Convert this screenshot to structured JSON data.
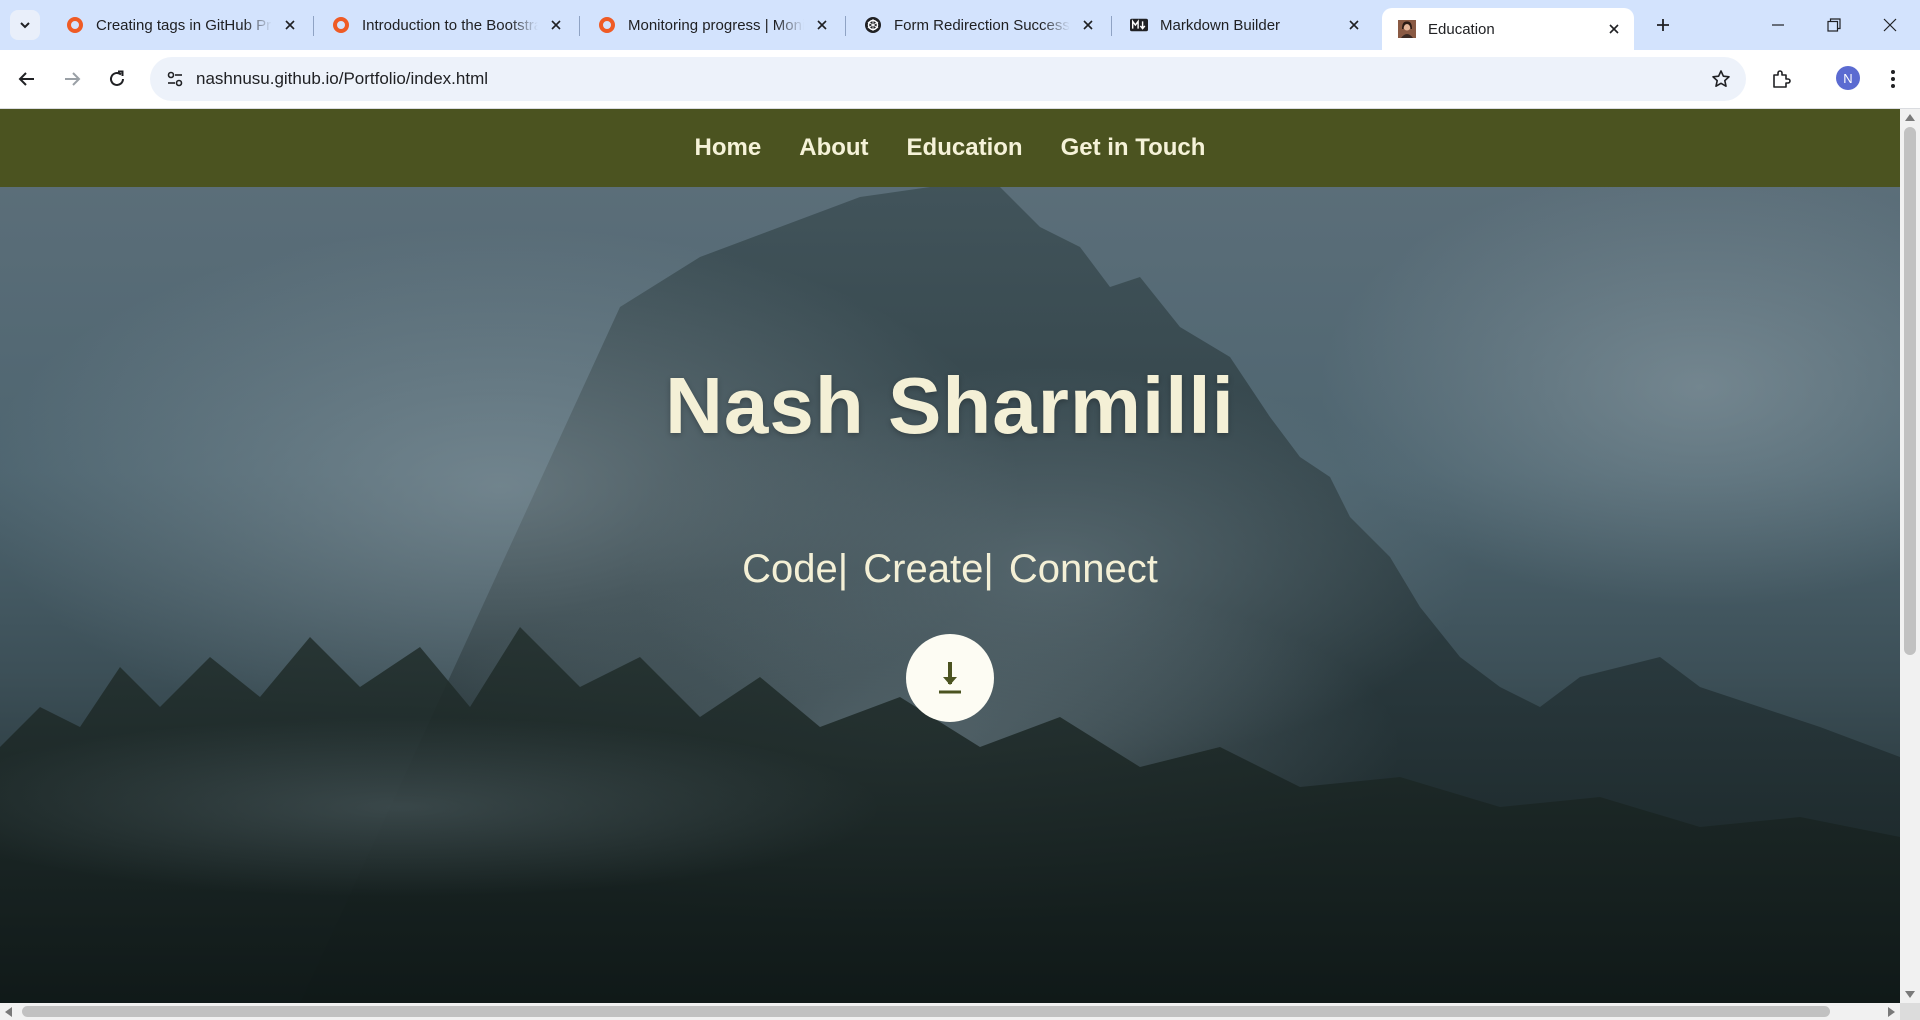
{
  "browser": {
    "tabs": [
      {
        "title": "Creating tags in GitHub Pro",
        "icon": "orange-ring-icon",
        "active": false
      },
      {
        "title": "Introduction to the Bootstrap",
        "icon": "orange-ring-icon",
        "active": false
      },
      {
        "title": "Monitoring progress | Monitoring",
        "icon": "orange-ring-icon",
        "active": false
      },
      {
        "title": "Form Redirection Success",
        "icon": "openai-icon",
        "active": false
      },
      {
        "title": "Markdown Builder",
        "icon": "markdown-icon",
        "active": false
      },
      {
        "title": "Education",
        "icon": "portrait-icon",
        "active": true
      }
    ],
    "url": "nashnusu.github.io/Portfolio/index.html",
    "profile_initial": "N"
  },
  "site": {
    "nav": [
      "Home",
      "About",
      "Education",
      "Get in Touch"
    ],
    "hero_title": "Nash Sharmilli",
    "tagline": [
      "Code|",
      "Create|",
      "Connect"
    ],
    "nav_color": "#4b5320",
    "text_color": "#f4f0d6"
  }
}
